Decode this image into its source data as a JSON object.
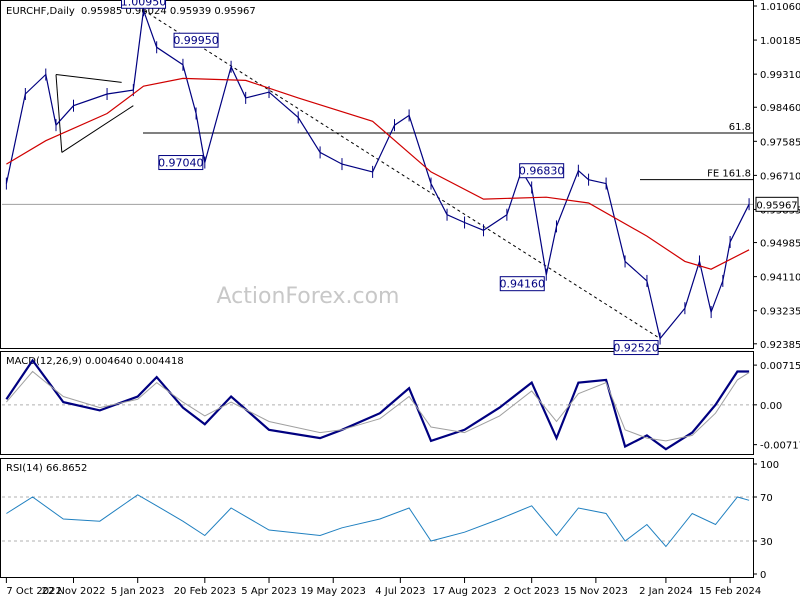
{
  "chart_data": [
    {
      "type": "line",
      "title": "EURCHF,Daily",
      "ohlc": "0.95985 0.96024 0.95939 0.95967",
      "watermark": "ActionForex.com",
      "y_ticks": [
        "1.01060",
        "1.00185",
        "0.99310",
        "0.98460",
        "0.97585",
        "0.96710",
        "0.95835",
        "0.94985",
        "0.94110",
        "0.93235",
        "0.92385"
      ],
      "ylim": [
        0.9238,
        1.0106
      ],
      "x_ticks": [
        "7 Oct 2022",
        "22 Nov 2022",
        "5 Jan 2023",
        "20 Feb 2023",
        "5 Apr 2023",
        "19 May 2023",
        "4 Jul 2023",
        "17 Aug 2023",
        "2 Oct 2023",
        "15 Nov 2023",
        "2 Jan 2024",
        "15 Feb 2024"
      ],
      "price_series": {
        "name": "EURCHF",
        "x": [
          "2022-10-07",
          "2022-10-20",
          "2022-11-03",
          "2022-11-10",
          "2022-11-22",
          "2022-12-15",
          "2023-01-02",
          "2023-01-09",
          "2023-01-18",
          "2023-02-05",
          "2023-02-14",
          "2023-02-20",
          "2023-03-10",
          "2023-03-20",
          "2023-04-05",
          "2023-04-25",
          "2023-05-10",
          "2023-05-25",
          "2023-06-15",
          "2023-06-30",
          "2023-07-10",
          "2023-07-25",
          "2023-08-05",
          "2023-08-17",
          "2023-08-30",
          "2023-09-15",
          "2023-09-25",
          "2023-10-02",
          "2023-10-12",
          "2023-10-19",
          "2023-11-03",
          "2023-11-10",
          "2023-11-22",
          "2023-12-05",
          "2023-12-20",
          "2023-12-29",
          "2024-01-15",
          "2024-01-25",
          "2024-02-02",
          "2024-02-10",
          "2024-02-15",
          "2024-02-28"
        ],
        "close": [
          0.965,
          0.988,
          0.993,
          0.98,
          0.985,
          0.988,
          0.989,
          1.0095,
          1.0,
          0.9955,
          0.983,
          0.9704,
          0.995,
          0.987,
          0.9885,
          0.982,
          0.973,
          0.97,
          0.968,
          0.98,
          0.9825,
          0.965,
          0.957,
          0.955,
          0.953,
          0.957,
          0.9683,
          0.964,
          0.9416,
          0.954,
          0.9683,
          0.966,
          0.965,
          0.945,
          0.94,
          0.9252,
          0.933,
          0.945,
          0.932,
          0.94,
          0.95,
          0.9597
        ]
      },
      "ma_series": {
        "x": [
          "2022-10-07",
          "2022-11-03",
          "2022-12-15",
          "2023-01-09",
          "2023-02-05",
          "2023-03-20",
          "2023-04-25",
          "2023-06-15",
          "2023-07-25",
          "2023-08-30",
          "2023-10-12",
          "2023-11-10",
          "2023-12-20",
          "2024-01-15",
          "2024-02-02",
          "2024-02-28"
        ],
        "values": [
          0.97,
          0.976,
          0.983,
          0.99,
          0.992,
          0.9915,
          0.987,
          0.981,
          0.968,
          0.961,
          0.9615,
          0.96,
          0.9515,
          0.945,
          0.943,
          0.948
        ]
      },
      "current_price_label": "0.95967",
      "annotations": [
        {
          "label": "1.00950",
          "x": "2023-01-09",
          "y": 1.0095
        },
        {
          "label": "0.99950",
          "x": "2023-02-14",
          "y": 0.9995
        },
        {
          "label": "0.97040",
          "x": "2023-02-20",
          "y": 0.9704
        },
        {
          "label": "0.96830",
          "x": "2023-10-02",
          "y": 0.9683
        },
        {
          "label": "0.94160",
          "x": "2023-10-12",
          "y": 0.9416
        },
        {
          "label": "0.92520",
          "x": "2023-12-29",
          "y": 0.9252
        }
      ],
      "levels": [
        {
          "label": "61.8",
          "y": 0.978
        },
        {
          "label": "FE 161.8",
          "y": 0.966
        }
      ]
    },
    {
      "type": "line",
      "title": "MACD(12,26,9) 0.004640 0.004418",
      "y_ticks": [
        "0.007159",
        "0.00",
        "-0.007173"
      ],
      "ylim": [
        -0.0085,
        0.0088
      ],
      "x": [
        "2022-10-07",
        "2022-10-25",
        "2022-11-15",
        "2022-12-10",
        "2023-01-05",
        "2023-01-18",
        "2023-02-05",
        "2023-02-20",
        "2023-03-10",
        "2023-04-05",
        "2023-05-10",
        "2023-05-25",
        "2023-06-20",
        "2023-07-10",
        "2023-07-25",
        "2023-08-17",
        "2023-09-10",
        "2023-10-02",
        "2023-10-19",
        "2023-11-03",
        "2023-11-22",
        "2023-12-05",
        "2023-12-20",
        "2024-01-02",
        "2024-01-20",
        "2024-02-05",
        "2024-02-20",
        "2024-02-28"
      ],
      "series": [
        {
          "name": "MACD",
          "values": [
            0.001,
            0.008,
            0.0005,
            -0.001,
            0.0015,
            0.005,
            -0.0005,
            -0.0035,
            0.0015,
            -0.0045,
            -0.006,
            -0.0045,
            -0.0015,
            0.003,
            -0.0065,
            -0.0045,
            -0.0005,
            0.004,
            -0.006,
            0.004,
            0.0045,
            -0.0075,
            -0.0055,
            -0.008,
            -0.005,
            0.0,
            0.006,
            0.006
          ]
        },
        {
          "name": "Signal",
          "values": [
            0.0005,
            0.006,
            0.0015,
            -0.0005,
            0.001,
            0.004,
            0.0005,
            -0.002,
            0.0005,
            -0.003,
            -0.005,
            -0.0045,
            -0.0025,
            0.0015,
            -0.004,
            -0.005,
            -0.002,
            0.0025,
            -0.003,
            0.002,
            0.004,
            -0.0045,
            -0.006,
            -0.0065,
            -0.0055,
            -0.0015,
            0.0045,
            0.0058
          ]
        }
      ]
    },
    {
      "type": "line",
      "title": "RSI(14) 66.8652",
      "y_ticks": [
        "100",
        "70",
        "30",
        "0"
      ],
      "ylim": [
        0,
        100
      ],
      "levels": [
        70,
        30
      ],
      "series": [
        {
          "name": "RSI",
          "x": [
            "2022-10-07",
            "2022-10-25",
            "2022-11-15",
            "2022-12-10",
            "2023-01-05",
            "2023-01-18",
            "2023-02-05",
            "2023-02-20",
            "2023-03-10",
            "2023-04-05",
            "2023-05-10",
            "2023-05-25",
            "2023-06-20",
            "2023-07-10",
            "2023-07-25",
            "2023-08-17",
            "2023-09-10",
            "2023-10-02",
            "2023-10-19",
            "2023-11-03",
            "2023-11-22",
            "2023-12-05",
            "2023-12-20",
            "2024-01-02",
            "2024-01-20",
            "2024-02-05",
            "2024-02-20",
            "2024-02-28"
          ],
          "values": [
            55,
            70,
            50,
            48,
            72,
            62,
            48,
            35,
            60,
            40,
            35,
            42,
            50,
            60,
            30,
            38,
            50,
            62,
            35,
            60,
            55,
            30,
            45,
            25,
            55,
            45,
            70,
            67
          ]
        }
      ]
    }
  ],
  "colors": {
    "price": "#000080",
    "ma": "#d00000",
    "macd": "#000080",
    "signal": "#a0a0a0",
    "rsi": "#2080c0",
    "level_line": "#000000",
    "grid_dash": "#b0b0b0"
  }
}
